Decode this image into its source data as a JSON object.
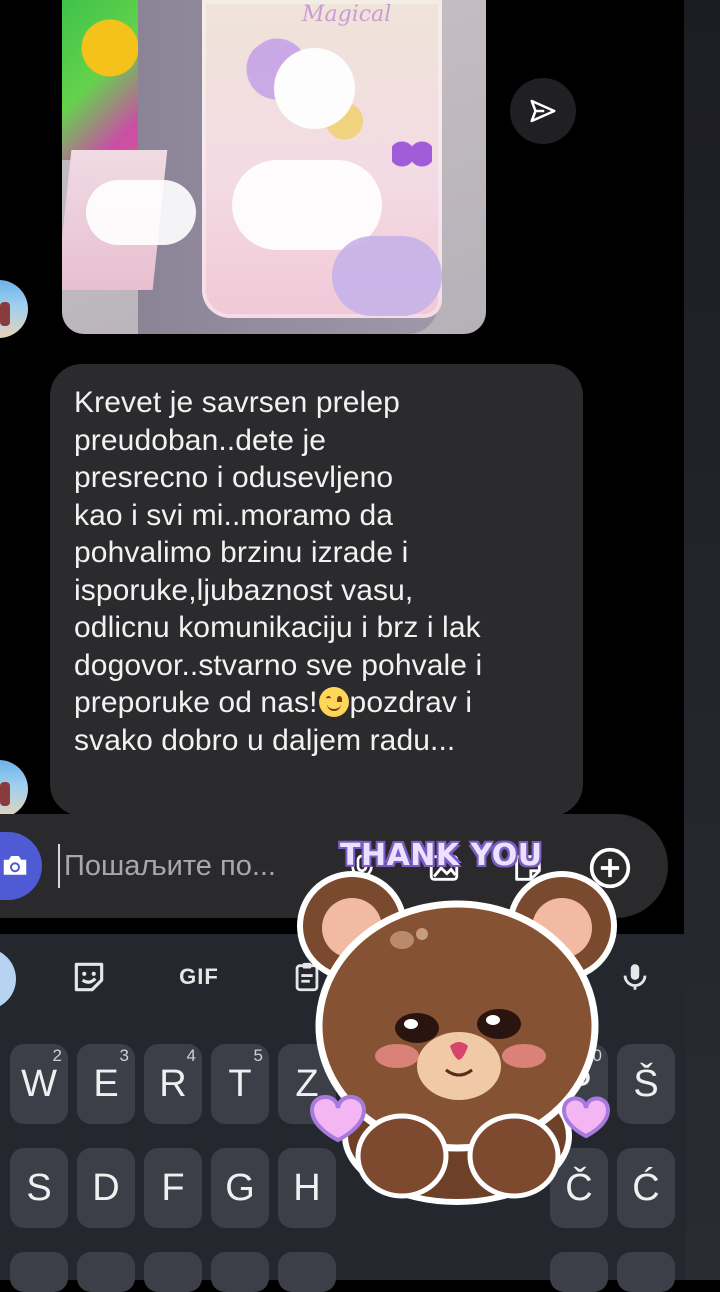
{
  "message": {
    "lines": [
      "Krevet je savrsen prelep",
      "preudoban..dete je",
      "presrecno i odusevljeno",
      "kao i svi mi..moramo da",
      "pohvalimo brzinu izrade i",
      "isporuke,ljubaznost vasu,",
      "odlicnu komunikaciju i brz i lak",
      "dogovor..stvarno sve pohvale i"
    ],
    "line9_before_emoji": "preporuke od nas!",
    "line9_after_emoji": "pozdrav i",
    "line10": "svako dobro u daljem radu..."
  },
  "composer": {
    "placeholder": "Пошаљите по..."
  },
  "sticker": {
    "text": "THANK YOU"
  },
  "keyboard": {
    "toolbar": {
      "gif_label": "GIF"
    },
    "row1": [
      {
        "label": "W",
        "alt": "2"
      },
      {
        "label": "E",
        "alt": "3"
      },
      {
        "label": "R",
        "alt": "4"
      },
      {
        "label": "T",
        "alt": "5"
      },
      {
        "label": "Z",
        "alt": "6"
      },
      {
        "label": "P",
        "alt": "0"
      },
      {
        "label": "Š",
        "alt": ""
      }
    ],
    "row2": [
      {
        "label": "S"
      },
      {
        "label": "D"
      },
      {
        "label": "F"
      },
      {
        "label": "G"
      },
      {
        "label": "H"
      },
      {
        "label": "Č"
      },
      {
        "label": "Ć"
      }
    ]
  },
  "icons": {
    "share": "paper-plane-icon",
    "camera": "camera-icon",
    "mic": "microphone-icon",
    "gallery": "image-icon",
    "sticker": "sticker-icon",
    "add": "plus-circle-icon",
    "emoji_keyboard": "emoji-sticker-icon",
    "clipboard": "clipboard-icon",
    "keyboard_mic": "microphone-icon"
  },
  "colors": {
    "bubble": "#2b2b2e",
    "camera_button": "#4f5bd5",
    "keyboard_bg": "#25272f",
    "key_bg": "#3c3f48"
  }
}
